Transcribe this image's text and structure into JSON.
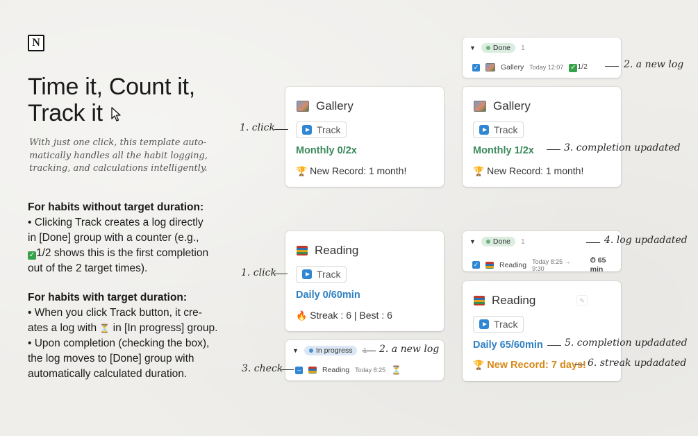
{
  "left": {
    "logo": "N",
    "title_line1": "Time it, Count it,",
    "title_line2": "Track it",
    "subtitle": "With just one click, this template auto-matically handles all the habit logging, tracking, and calculations intelligently.",
    "section1": {
      "heading": "For habits without target duration:",
      "line1": "• Clicking Track creates a log directly",
      "line2": "in [Done] group with a counter (e.g.,",
      "line3_value": "1/2",
      "line3_rest": " shows this is the first completion",
      "line4": "out of the 2 target times)."
    },
    "section2": {
      "heading": "For habits with target duration:",
      "line1": "• When you click Track button, it cre-",
      "line2a": "ates a log with ",
      "line2b": " in [In progress] group.",
      "line3": "• Upon completion (checking the box),",
      "line4": "the log moves to [Done] group with",
      "line5": "automatically calculated duration."
    }
  },
  "gallery_before": {
    "name": "Gallery",
    "track": "Track",
    "progress": "Monthly 0/2x",
    "record": "New Record: 1 month!"
  },
  "gallery_after": {
    "name": "Gallery",
    "track": "Track",
    "progress": "Monthly 1/2x",
    "record": "New Record: 1 month!"
  },
  "done_log_gallery": {
    "tag": "Done",
    "count": "1",
    "item": "Gallery",
    "time": "Today 12:07",
    "counter": "1/2"
  },
  "reading_before": {
    "name": "Reading",
    "track": "Track",
    "progress": "Daily 0/60min",
    "streak": "Streak : 6 | Best : 6"
  },
  "inprogress_log": {
    "tag": "In progress",
    "count": "1",
    "item": "Reading",
    "time": "Today 8:25"
  },
  "done_log_reading": {
    "tag": "Done",
    "count": "1",
    "item": "Reading",
    "time": "Today 8:25 → 9:30",
    "duration": "65 min"
  },
  "reading_after": {
    "name": "Reading",
    "track": "Track",
    "progress": "Daily 65/60min",
    "record": "New Record: 7 days!"
  },
  "annotations": {
    "click1": "1. click",
    "new_log1": "2. a new log",
    "completion1": "3. completion upadated",
    "click2": "1. click",
    "new_log2": "2. a new log",
    "check": "3. check",
    "log_updated": "4. log updadated",
    "completion2": "5. completion updadated",
    "streak": "6. streak updadated"
  },
  "colors": {
    "done_dot": "#6fae7f",
    "progress_dot": "#4a8fd1",
    "green_text": "#3a8a5a",
    "blue_text": "#2d7fc4",
    "orange_text": "#d8891a"
  }
}
